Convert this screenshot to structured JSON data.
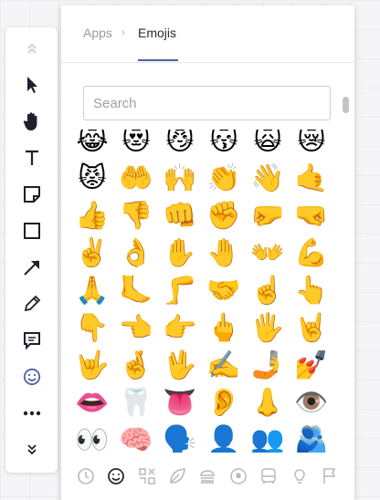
{
  "tabs": {
    "apps_label": "Apps",
    "separator": "›",
    "emojis_label": "Emojis"
  },
  "search": {
    "placeholder": "Search"
  },
  "toolbar": {
    "items": [
      {
        "icon": "collapse-up-icon"
      },
      {
        "icon": "select-pointer-icon"
      },
      {
        "icon": "hand-pan-icon"
      },
      {
        "icon": "text-icon"
      },
      {
        "icon": "sticky-note-icon"
      },
      {
        "icon": "rectangle-shape-icon"
      },
      {
        "icon": "arrow-line-icon"
      },
      {
        "icon": "pencil-icon"
      },
      {
        "icon": "comment-icon"
      },
      {
        "icon": "emoji-icon"
      },
      {
        "icon": "more-icon"
      },
      {
        "icon": "collapse-down-icon"
      }
    ]
  },
  "emojis": [
    "😹",
    "😻",
    "😼",
    "😽",
    "🙀",
    "😿",
    "😾",
    "🤲",
    "🙌",
    "👏",
    "👋",
    "🤙",
    "👍",
    "👎",
    "👊",
    "✊",
    "🤛",
    "🤜",
    "✌️",
    "👌",
    "✋",
    "🤚",
    "👐",
    "💪",
    "🙏",
    "🦶",
    "🦵",
    "🤝",
    "☝️",
    "👆",
    "👇",
    "👈",
    "👉",
    "🖕",
    "🖐️",
    "🤘",
    "🤟",
    "🤞",
    "🖖",
    "✍️",
    "🤳",
    "💅",
    "👄",
    "🦷",
    "👅",
    "👂",
    "👃",
    "👁️",
    "👀",
    "🧠",
    "🗣️",
    "👤",
    "👥",
    "🫂"
  ],
  "categories": [
    {
      "icon": "recent-clock-icon"
    },
    {
      "icon": "smileys-icon"
    },
    {
      "icon": "symbols-icon"
    },
    {
      "icon": "nature-leaf-icon"
    },
    {
      "icon": "food-icon"
    },
    {
      "icon": "activity-ball-icon"
    },
    {
      "icon": "travel-bus-icon"
    },
    {
      "icon": "objects-bulb-icon"
    },
    {
      "icon": "flags-icon"
    }
  ],
  "colors": {
    "accent": "#4f5fa8",
    "text": "#2a2a35",
    "muted": "#9a9aa6"
  }
}
